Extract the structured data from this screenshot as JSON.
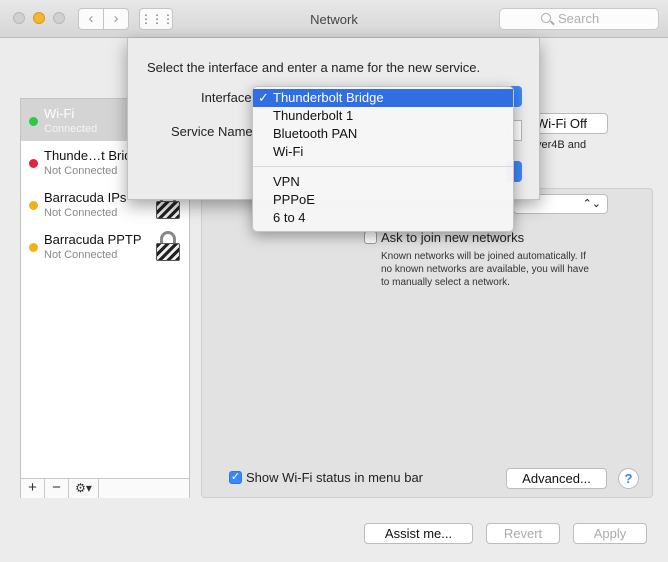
{
  "window": {
    "title": "Network",
    "search_placeholder": "Search"
  },
  "toolbar": {
    "back": "‹",
    "forward": "›",
    "grid": "⋮⋮⋮"
  },
  "sidebar": {
    "services": [
      {
        "name": "Wi-Fi",
        "status": "Connected",
        "color": "#2fc843",
        "selected": true
      },
      {
        "name": "Thunde…t Brid",
        "status": "Not Connected",
        "color": "#e2233a",
        "selected": false
      },
      {
        "name": "Barracuda IPs",
        "status": "Not Connected",
        "color": "#f5b017",
        "selected": false
      },
      {
        "name": "Barracuda PPTP",
        "status": "Not Connected",
        "color": "#f5b017",
        "selected": false
      }
    ],
    "tools": {
      "add": "+",
      "remove": "−",
      "gear": "⚙▾"
    }
  },
  "main": {
    "wifi_off_button": "Wi-Fi Off",
    "partial_text": "ver4B and",
    "ask_join_label": "Ask to join new networks",
    "ask_join_desc_1": "Known networks will be joined automatically. If",
    "ask_join_desc_2": "no known networks are available, you will have",
    "ask_join_desc_3": "to manually select a network.",
    "show_status_label": "Show Wi-Fi status in menu bar",
    "advanced_button": "Advanced...",
    "help": "?"
  },
  "bottom": {
    "assist_button": "Assist me...",
    "revert_button": "Revert",
    "apply_button": "Apply"
  },
  "sheet": {
    "prompt": "Select the interface and enter a name for the new service.",
    "interface_label": "Interface",
    "service_name_label": "Service Name"
  },
  "interface_menu": {
    "group1": [
      "Thunderbolt Bridge",
      "Thunderbolt 1",
      "Bluetooth PAN",
      "Wi-Fi"
    ],
    "group2": [
      "VPN",
      "PPPoE",
      "6 to 4"
    ],
    "checkmark": "✓",
    "selected": "Thunderbolt Bridge"
  }
}
